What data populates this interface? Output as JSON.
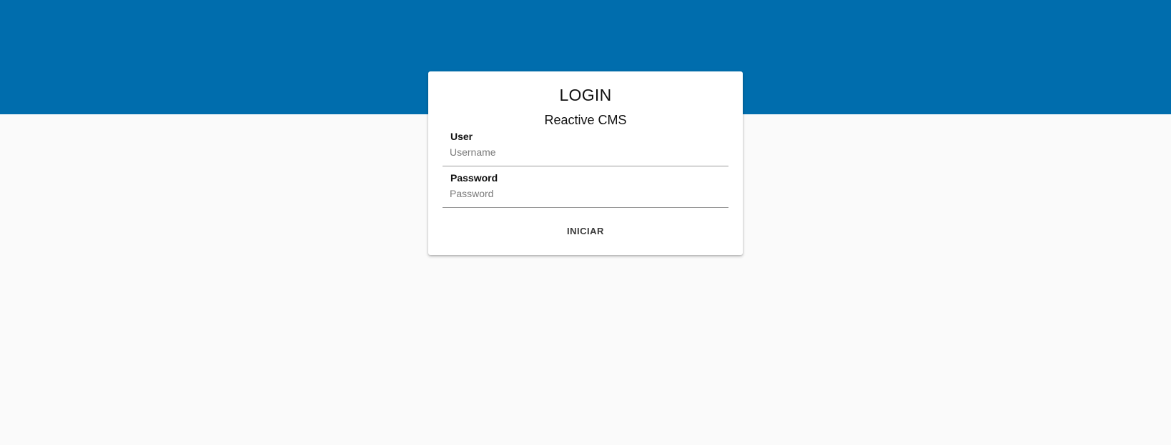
{
  "theme": {
    "header_color": "#006dad",
    "background_color": "#fafafa",
    "card_color": "#ffffff"
  },
  "login": {
    "title": "LOGIN",
    "subtitle": "Reactive CMS",
    "user_field": {
      "label": "User",
      "placeholder": "Username",
      "value": ""
    },
    "password_field": {
      "label": "Password",
      "placeholder": "Password",
      "value": ""
    },
    "submit_label": "INICIAR"
  }
}
